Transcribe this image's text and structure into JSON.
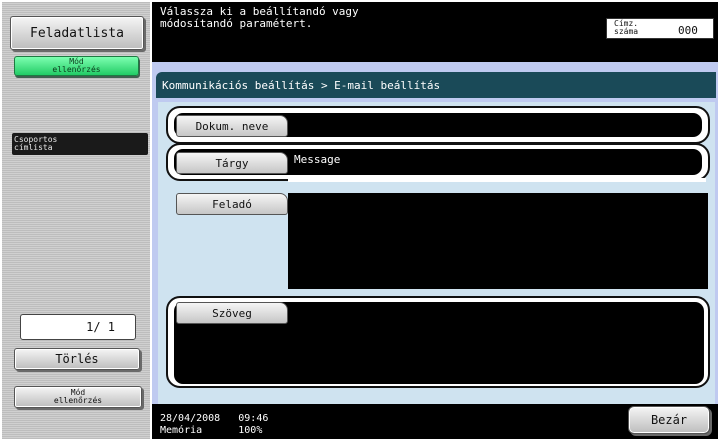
{
  "sidebar": {
    "job_list": "Feladatlista",
    "check_mode_top": "Mód\nellenőrzés",
    "group_address": "Csoportos\ncímlista",
    "page_counter": "1/  1",
    "delete": "Törlés",
    "check_mode_bottom": "Mód\nellenőrzés"
  },
  "header": {
    "instruction": "Válassza ki a beállítandó vagy\nmódosítandó paramétert.",
    "address_count_label": "Címz.\nszáma",
    "address_count_value": "000"
  },
  "main": {
    "breadcrumb": "Kommunikációs beállítás > E-mail beállítás",
    "fields": {
      "document_name": {
        "label": "Dokum. neve",
        "value": ""
      },
      "subject": {
        "label": "Tárgy",
        "value": "Message"
      },
      "sender": {
        "label": "Feladó",
        "value": ""
      },
      "body": {
        "label": "Szöveg",
        "value": ""
      }
    }
  },
  "footer": {
    "datetime": "28/04/2008   09:46",
    "memory": "Memória      100%",
    "close": "Bezár"
  }
}
